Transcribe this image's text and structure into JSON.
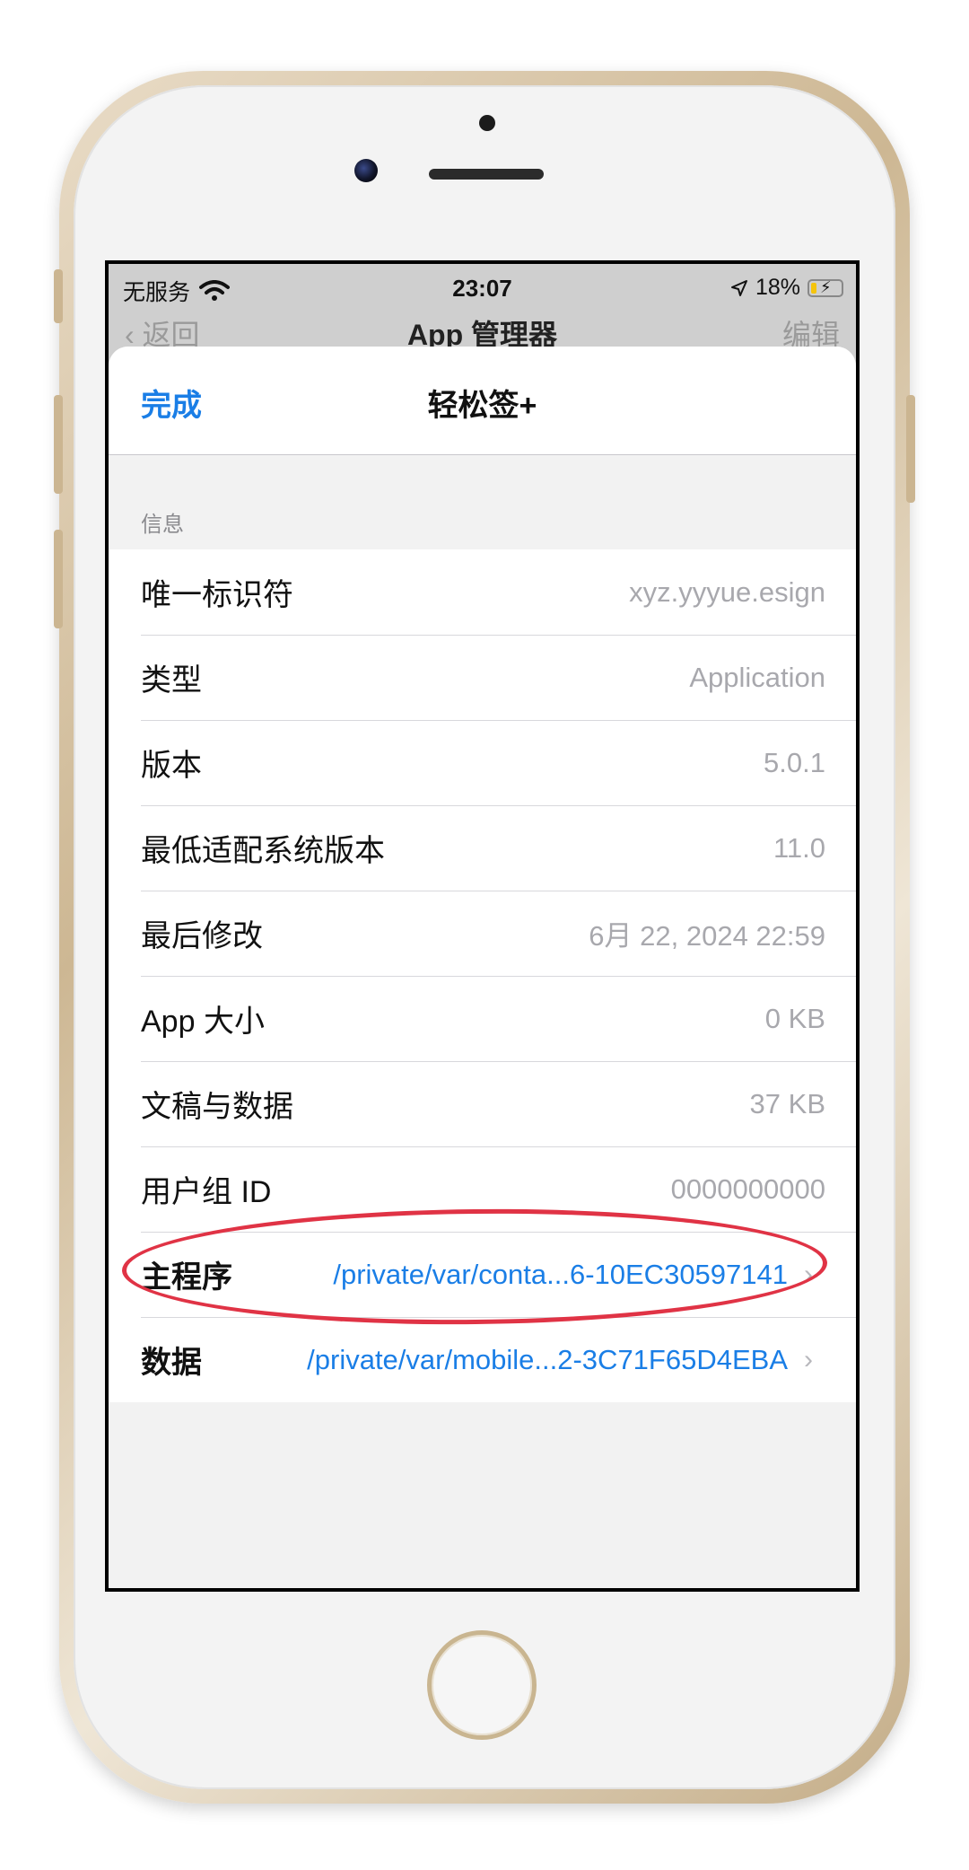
{
  "status_bar": {
    "carrier": "无服务",
    "time": "23:07",
    "battery_percent": "18%",
    "battery_level": 0.18
  },
  "background_nav": {
    "back_label": "返回",
    "title": "App 管理器",
    "edit_label": "编辑"
  },
  "sheet": {
    "done_label": "完成",
    "title": "轻松签+",
    "section_label": "信息",
    "rows": [
      {
        "label": "唯一标识符",
        "value": "xyz.yyyue.esign"
      },
      {
        "label": "类型",
        "value": "Application"
      },
      {
        "label": "版本",
        "value": "5.0.1"
      },
      {
        "label": "最低适配系统版本",
        "value": "11.0"
      },
      {
        "label": "最后修改",
        "value": "6月 22, 2024 22:59"
      },
      {
        "label": "App 大小",
        "value": "0 KB"
      },
      {
        "label": "文稿与数据",
        "value": "37 KB"
      },
      {
        "label": "用户组 ID",
        "value": "0000000000"
      }
    ],
    "path_rows": [
      {
        "label": "主程序",
        "value": "/private/var/conta...6-10EC30597141"
      },
      {
        "label": "数据",
        "value": "/private/var/mobile...2-3C71F65D4EBA"
      }
    ]
  },
  "colors": {
    "accent": "#1a7ee6",
    "highlight": "#e03345",
    "battery": "#f5c40c"
  }
}
